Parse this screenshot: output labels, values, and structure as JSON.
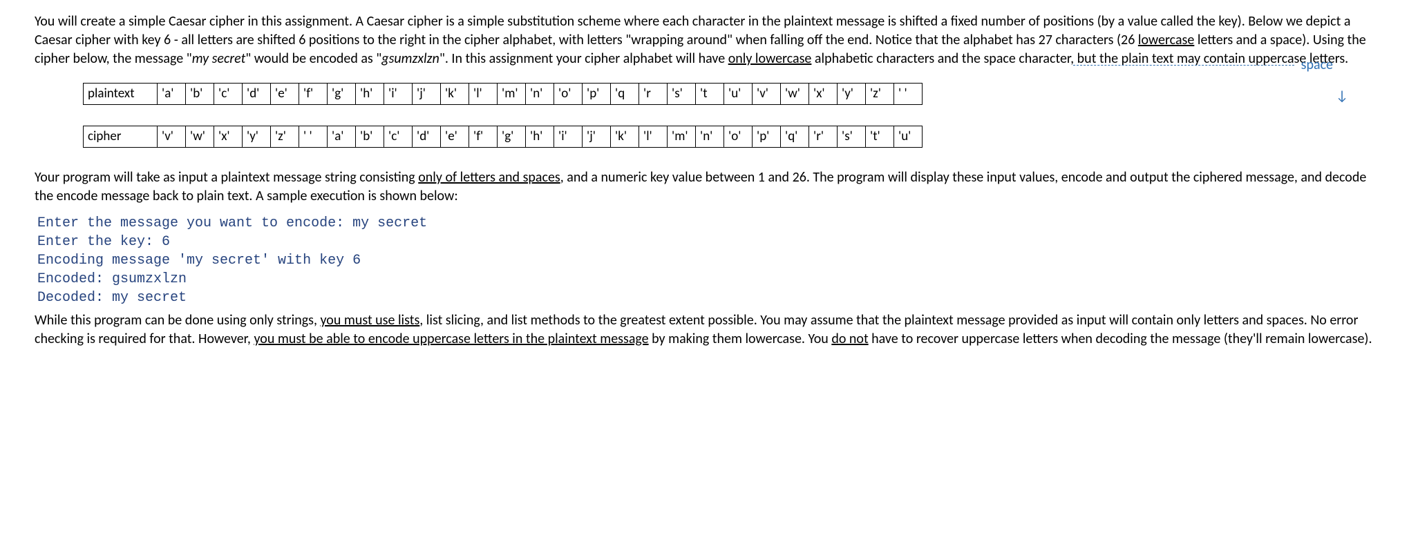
{
  "para1_parts": [
    {
      "t": "You will create a simple Caesar cipher in this assignment.  A Caesar cipher is a simple substitution scheme where each character in the plaintext message is shifted a fixed number of positions (by a value called the key).  Below we depict a Caesar cipher with key 6 - all letters are shifted 6 positions to the right in the cipher alphabet, with letters \"wrapping around\" when falling off the end.  Notice that the alphabet has 27 characters (26 "
    },
    {
      "t": "lowercase",
      "u": true
    },
    {
      "t": " letters and a space).  Using the cipher below, the message \""
    },
    {
      "t": "my secret",
      "i": true
    },
    {
      "t": "\" would be encoded as \""
    },
    {
      "t": "gsumzxlzn",
      "i": true
    },
    {
      "t": "\".  In this assignment your cipher alphabet will have "
    },
    {
      "t": "only lowercase",
      "u": true
    },
    {
      "t": " alphabetic characters and the space character, but the plain text may contain uppercase letters."
    }
  ],
  "space_label": "space",
  "plaintext_label": "plaintext",
  "cipher_label": "cipher",
  "plaintext_row": [
    "'a'",
    "'b'",
    "'c'",
    "'d'",
    "'e'",
    "'f'",
    "'g'",
    "'h'",
    "'i'",
    "'j'",
    "'k'",
    "'l'",
    "'m'",
    "'n'",
    "'o'",
    "'p'",
    "'q",
    "'r",
    "'s'",
    "'t",
    "'u'",
    "'v'",
    "'w'",
    "'x'",
    "'y'",
    "'z'",
    "' '"
  ],
  "cipher_row": [
    "'v'",
    "'w'",
    "'x'",
    "'y'",
    "'z'",
    "' '",
    "'a'",
    "'b'",
    "'c'",
    "'d'",
    "'e'",
    "'f'",
    "'g'",
    "'h'",
    "'i'",
    "'j'",
    "'k'",
    "'l'",
    "'m'",
    "'n'",
    "'o'",
    "'p'",
    "'q'",
    "'r'",
    "'s'",
    "'t'",
    "'u'"
  ],
  "para2_parts": [
    {
      "t": "Your program will take as input a plaintext message string consisting "
    },
    {
      "t": "only of letters and spaces",
      "u": true
    },
    {
      "t": ", and a numeric key value between 1 and 26.  The program will display these input values, encode and output the ciphered message, and decode the encode message back to plain text.  A sample execution is shown below:"
    }
  ],
  "code_lines": [
    "Enter the message you want to encode: my secret",
    "Enter the key: 6",
    "Encoding message 'my secret' with key 6",
    "Encoded: gsumzxlzn",
    "Decoded: my secret"
  ],
  "para3_parts": [
    {
      "t": "While this program can be done using only strings, "
    },
    {
      "t": "you must use lists",
      "u": true
    },
    {
      "t": ", list slicing, and list methods to the greatest extent possible.  You may assume that the plaintext message provided as input will contain only letters and spaces.  No error checking is required for that.  However, "
    },
    {
      "t": "you must be able to encode uppercase letters in the plaintext message",
      "u": true
    },
    {
      "t": " by making them lowercase. You "
    },
    {
      "t": "do not",
      "u": true
    },
    {
      "t": " have to recover uppercase letters when decoding the message (they'll remain lowercase)."
    }
  ]
}
